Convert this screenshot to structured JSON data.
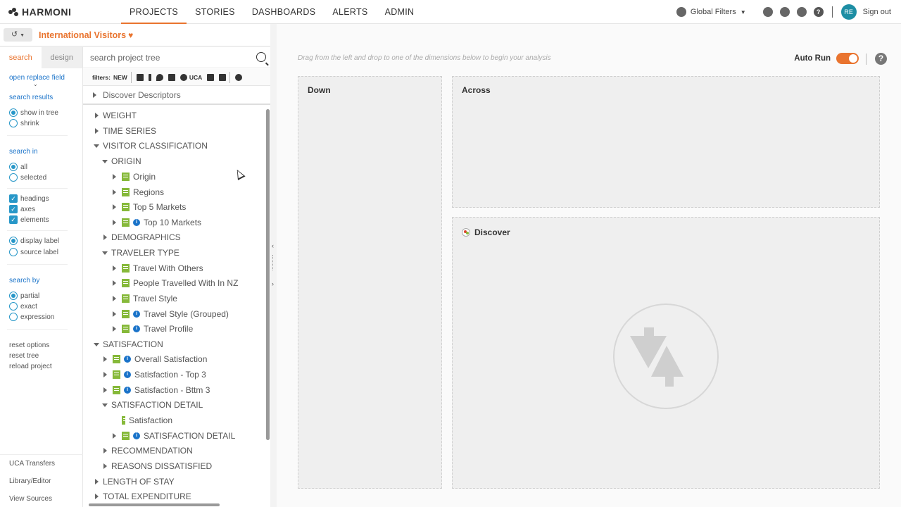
{
  "brand": {
    "name": "HARMONI"
  },
  "nav": {
    "items": [
      "PROJECTS",
      "STORIES",
      "DASHBOARDS",
      "ALERTS",
      "ADMIN"
    ],
    "active": "PROJECTS"
  },
  "topright": {
    "global_filters": "Global Filters",
    "user_initials": "RE",
    "sign_out": "Sign out"
  },
  "project": {
    "title": "International Visitors"
  },
  "options": {
    "tabs": {
      "search": "search",
      "design": "design"
    },
    "open_replace_field": "open replace field",
    "search_results_heading": "search results",
    "show_in_tree": "show in tree",
    "shrink": "shrink",
    "search_in_heading": "search in",
    "all": "all",
    "selected": "selected",
    "headings": "headings",
    "axes": "axes",
    "elements": "elements",
    "display_label": "display label",
    "source_label": "source label",
    "search_by_heading": "search by",
    "partial": "partial",
    "exact": "exact",
    "expression": "expression",
    "reset_options": "reset options",
    "reset_tree": "reset tree",
    "reload_project": "reload project",
    "uca_transfers": "UCA Transfers",
    "library_editor": "Library/Editor",
    "view_sources": "View Sources"
  },
  "tree": {
    "search_placeholder": "search project tree",
    "filters_label": "filters:",
    "filter_new": "NEW",
    "filter_uca": "UCA",
    "discover_descriptors": "Discover Descriptors",
    "rows": [
      {
        "label": "WEIGHT"
      },
      {
        "label": "TIME SERIES"
      },
      {
        "label": "VISITOR CLASSIFICATION"
      },
      {
        "label": "ORIGIN"
      },
      {
        "label": "Origin"
      },
      {
        "label": "Regions"
      },
      {
        "label": "Top 5 Markets"
      },
      {
        "label": "Top 10 Markets"
      },
      {
        "label": "DEMOGRAPHICS"
      },
      {
        "label": "TRAVELER TYPE"
      },
      {
        "label": "Travel With Others"
      },
      {
        "label": "People Travelled With In NZ"
      },
      {
        "label": "Travel Style"
      },
      {
        "label": "Travel Style (Grouped)"
      },
      {
        "label": "Travel Profile"
      },
      {
        "label": "SATISFACTION"
      },
      {
        "label": "Overall Satisfaction"
      },
      {
        "label": "Satisfaction - Top 3"
      },
      {
        "label": "Satisfaction - Bttm 3"
      },
      {
        "label": "SATISFACTION DETAIL"
      },
      {
        "label": "Satisfaction"
      },
      {
        "label": "SATISFACTION DETAIL"
      },
      {
        "label": "RECOMMENDATION"
      },
      {
        "label": "REASONS DISSATISFIED"
      },
      {
        "label": "LENGTH OF STAY"
      },
      {
        "label": "TOTAL EXPENDITURE"
      }
    ]
  },
  "main": {
    "hint": "Drag from the left and drop to one of the dimensions below to begin your analysis",
    "auto_run": "Auto Run",
    "down": "Down",
    "across": "Across",
    "discover": "Discover"
  },
  "colors": {
    "accent": "#e9742f",
    "link": "#1a73c9",
    "check": "#2797c8",
    "variable_icon": "#86b93a"
  }
}
